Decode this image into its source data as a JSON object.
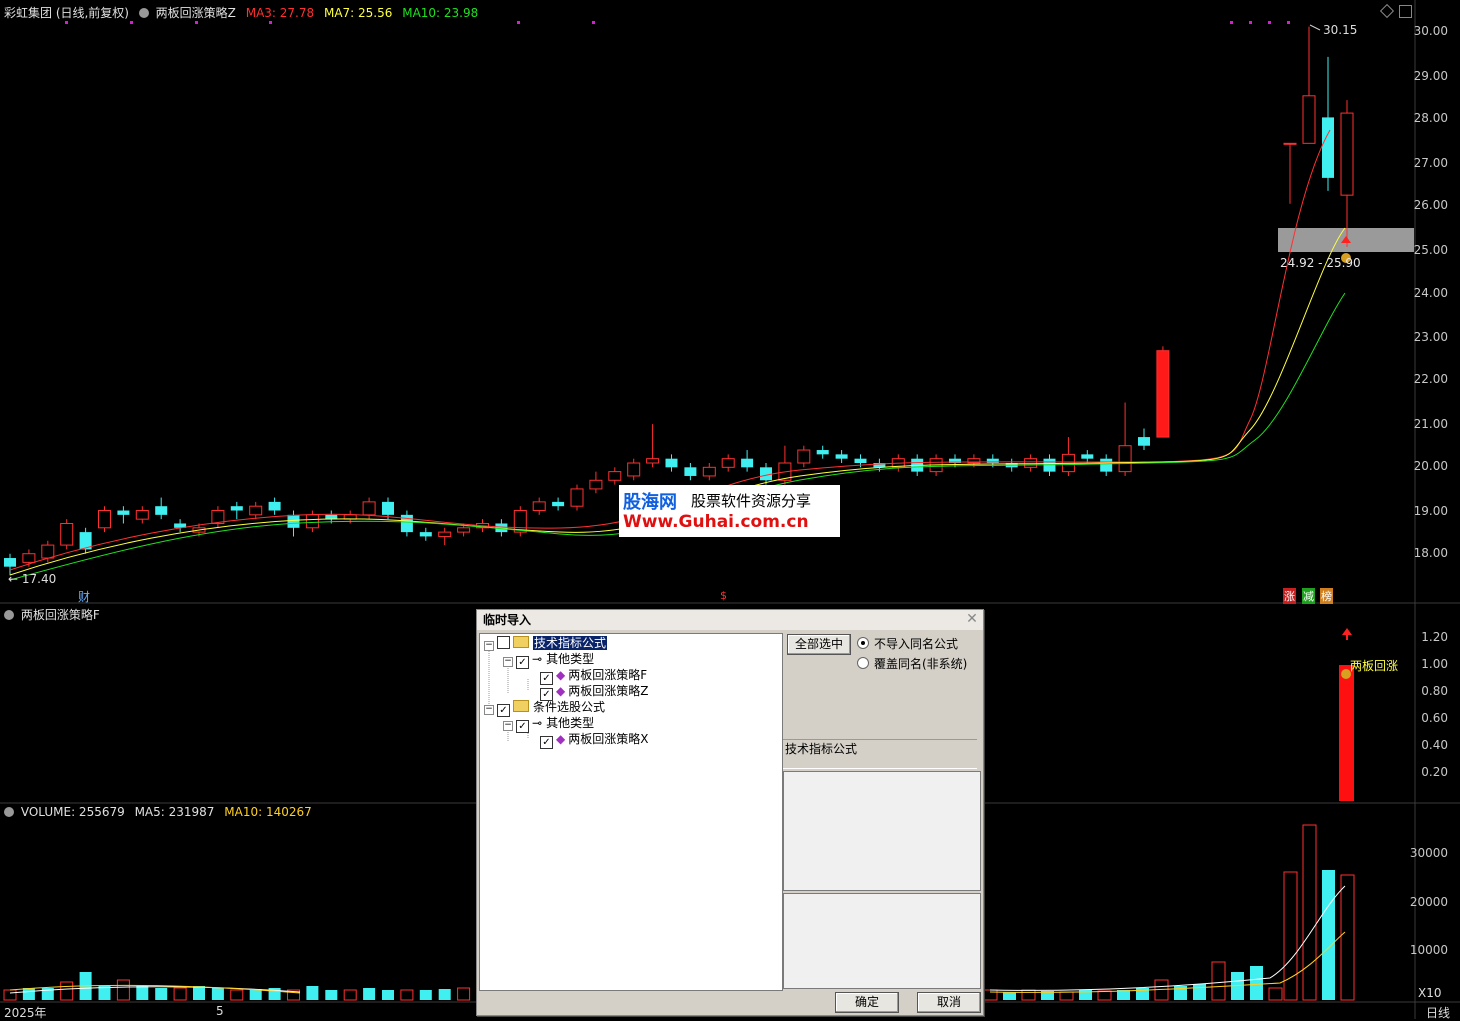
{
  "header": {
    "stock_title": "彩虹集团 (日线,前复权)",
    "indicator": "两板回涨策略Z",
    "ma3": "MA3: 27.78",
    "ma7": "MA7: 25.56",
    "ma10": "MA10: 23.98",
    "colors": {
      "ma3": "#ff3030",
      "ma7": "#ffff40",
      "ma10": "#20e020"
    }
  },
  "price_axis": [
    "30.00",
    "29.00",
    "28.00",
    "27.00",
    "26.00",
    "25.00",
    "24.00",
    "23.00",
    "22.00",
    "21.00",
    "20.00",
    "19.00",
    "18.00"
  ],
  "price_annotations": {
    "high": "30.15",
    "low": "17.40",
    "range": "24.92 - 25.90"
  },
  "markers": {
    "cai": "财",
    "s_mark": "$",
    "zhang": "涨",
    "jian": "减",
    "bang": "榜"
  },
  "sub_panel": {
    "title": "两板回涨策略F",
    "axis": [
      "1.20",
      "1.00",
      "0.80",
      "0.60",
      "0.40",
      "0.20"
    ],
    "signal_label": "两板回涨"
  },
  "volume_panel": {
    "volume": "VOLUME: 255679",
    "ma5": "MA5: 231987",
    "ma10": "MA10: 140267",
    "axis": [
      "30000",
      "20000",
      "10000"
    ],
    "unit": "X10"
  },
  "bottom_axis": {
    "year": "2025年",
    "month": "5",
    "period": "日线"
  },
  "watermark": {
    "line1_brand": "股海网",
    "line1_tag": "股票软件资源分享",
    "line2": "Www.Guhai.com.cn"
  },
  "dialog": {
    "title": "临时导入",
    "tree": [
      {
        "label": "技术指标公式",
        "checked": false,
        "selected": true
      },
      {
        "label": "其他类型",
        "checked": true
      },
      {
        "label": "两板回涨策略F",
        "checked": true
      },
      {
        "label": "两板回涨策略Z",
        "checked": true
      },
      {
        "label": "条件选股公式",
        "checked": true
      },
      {
        "label": "其他类型",
        "checked": true
      },
      {
        "label": "两板回涨策略X",
        "checked": true
      }
    ],
    "select_all": "全部选中",
    "radio_no_import": "不导入同名公式",
    "radio_overwrite": "覆盖同名(非系统)",
    "type_label": "技术指标公式",
    "ok": "确定",
    "cancel": "取消"
  }
}
